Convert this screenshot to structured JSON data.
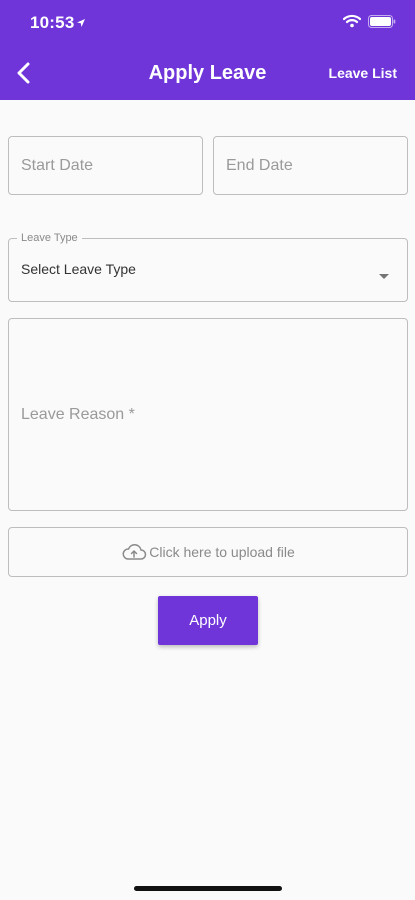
{
  "status_bar": {
    "time": "10:53"
  },
  "header": {
    "title": "Apply Leave",
    "leave_list_label": "Leave List"
  },
  "form": {
    "start_date_placeholder": "Start Date",
    "end_date_placeholder": "End Date",
    "leave_type_label": "Leave Type",
    "leave_type_value": "Select Leave Type",
    "leave_reason_placeholder": "Leave Reason *",
    "upload_label": "Click here to upload file",
    "apply_label": "Apply"
  },
  "colors": {
    "primary": "#6f35d9",
    "background": "#fafafa",
    "border": "#bdbdbd"
  },
  "icons": [
    "location-arrow-icon",
    "wifi-icon",
    "battery-icon",
    "back-chevron-icon",
    "dropdown-caret-icon",
    "cloud-upload-icon"
  ]
}
